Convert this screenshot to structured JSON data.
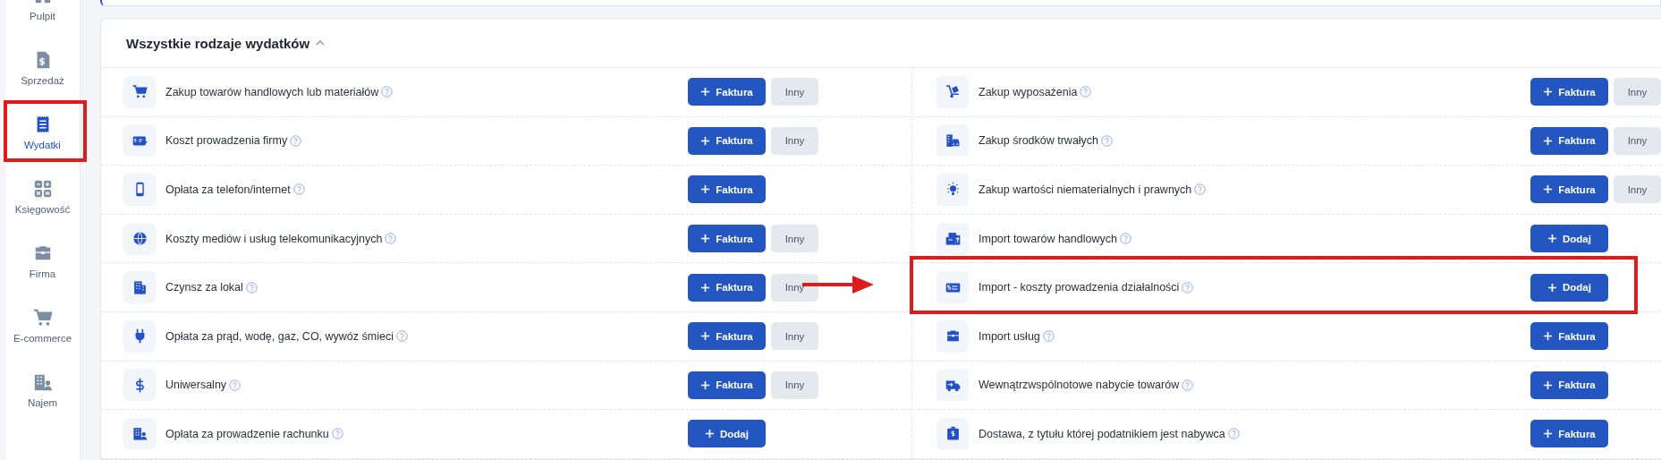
{
  "sidebar": {
    "items": [
      {
        "label": "Pulpit",
        "selected": false
      },
      {
        "label": "Sprzedaż",
        "selected": false
      },
      {
        "label": "Wydatki",
        "selected": true
      },
      {
        "label": "Księgowość",
        "selected": false
      },
      {
        "label": "Firma",
        "selected": false
      },
      {
        "label": "E-commerce",
        "selected": false
      },
      {
        "label": "Najem",
        "selected": false
      }
    ]
  },
  "section": {
    "title": "Wszystkie rodzaje wydatków",
    "expanded": true,
    "columns": [
      {
        "rows": [
          {
            "label": "Zakup towarów handlowych lub materiałów",
            "buttons": [
              {
                "kind": "primary",
                "label": "Faktura"
              },
              {
                "kind": "secondary",
                "label": "Inny"
              }
            ]
          },
          {
            "label": "Koszt prowadzenia firmy",
            "buttons": [
              {
                "kind": "primary",
                "label": "Faktura"
              },
              {
                "kind": "secondary",
                "label": "Inny"
              }
            ]
          },
          {
            "label": "Opłata za telefon/internet",
            "buttons": [
              {
                "kind": "primary",
                "label": "Faktura"
              }
            ]
          },
          {
            "label": "Koszty mediów i usług telekomunikacyjnych",
            "buttons": [
              {
                "kind": "primary",
                "label": "Faktura"
              },
              {
                "kind": "secondary",
                "label": "Inny"
              }
            ]
          },
          {
            "label": "Czynsz za lokal",
            "buttons": [
              {
                "kind": "primary",
                "label": "Faktura"
              },
              {
                "kind": "secondary",
                "label": "Inny"
              }
            ]
          },
          {
            "label": "Opłata za prąd, wodę, gaz, CO, wywóz śmieci",
            "buttons": [
              {
                "kind": "primary",
                "label": "Faktura"
              },
              {
                "kind": "secondary",
                "label": "Inny"
              }
            ]
          },
          {
            "label": "Uniwersalny",
            "buttons": [
              {
                "kind": "primary",
                "label": "Faktura"
              },
              {
                "kind": "secondary",
                "label": "Inny"
              }
            ]
          },
          {
            "label": "Opłata za prowadzenie rachunku",
            "buttons": [
              {
                "kind": "primary",
                "label": "Dodaj"
              }
            ]
          }
        ]
      },
      {
        "rows": [
          {
            "label": "Zakup wyposażenia",
            "buttons": [
              {
                "kind": "primary",
                "label": "Faktura"
              },
              {
                "kind": "secondary",
                "label": "Inny"
              }
            ]
          },
          {
            "label": "Zakup środków trwałych",
            "buttons": [
              {
                "kind": "primary",
                "label": "Faktura"
              },
              {
                "kind": "secondary",
                "label": "Inny"
              }
            ]
          },
          {
            "label": "Zakup wartości niematerialnych i prawnych",
            "buttons": [
              {
                "kind": "primary",
                "label": "Faktura"
              },
              {
                "kind": "secondary",
                "label": "Inny"
              }
            ]
          },
          {
            "label": "Import towarów handlowych",
            "buttons": [
              {
                "kind": "primary",
                "label": "Dodaj"
              }
            ]
          },
          {
            "label": "Import - koszty prowadzenia działalności",
            "buttons": [
              {
                "kind": "primary",
                "label": "Dodaj"
              }
            ]
          },
          {
            "label": "Import usług",
            "buttons": [
              {
                "kind": "primary",
                "label": "Faktura"
              }
            ]
          },
          {
            "label": "Wewnątrzwspólnotowe nabycie towarów",
            "buttons": [
              {
                "kind": "primary",
                "label": "Faktura"
              }
            ]
          },
          {
            "label": "Dostawa, z tytułu której podatnikiem jest nabywca",
            "buttons": [
              {
                "kind": "primary",
                "label": "Faktura"
              }
            ]
          }
        ]
      }
    ]
  }
}
